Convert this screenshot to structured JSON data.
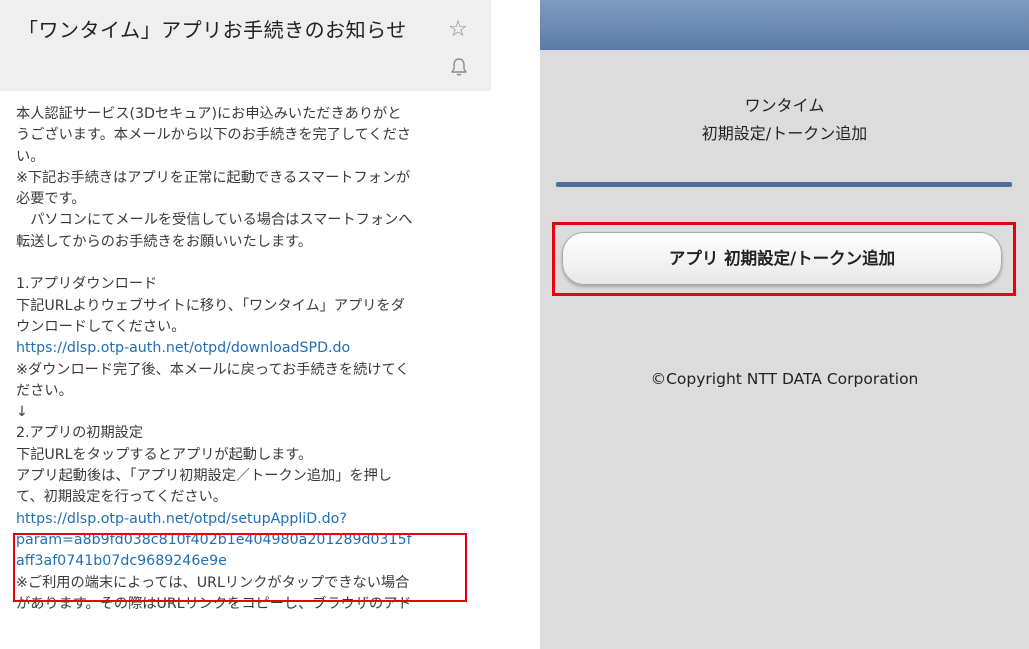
{
  "email": {
    "subject": "「ワンタイム」アプリお手続きのお知らせ",
    "icons": {
      "star": "star-icon",
      "bell": "bell-icon"
    },
    "body": {
      "intro": [
        "本人認証サービス(3Dセキュア)にお申込みいただきありがと",
        "うございます。本メールから以下のお手続きを完了してくださ",
        "い。",
        "※下記お手続きはアプリを正常に起動できるスマートフォンが",
        "必要です。",
        "　パソコンにてメールを受信している場合はスマートフォンへ",
        "転送してからのお手続きをお願いいたします。"
      ],
      "step1": {
        "heading": "1.アプリダウンロード",
        "text": [
          "下記URLよりウェブサイトに移り、「ワンタイム」アプリをダ",
          "ウンロードしてください。"
        ],
        "link": "https://dlsp.otp-auth.net/otpd/downloadSPD.do",
        "note": [
          "※ダウンロード完了後、本メールに戻ってお手続きを続けてく",
          "ださい。"
        ]
      },
      "arrow": "↓",
      "step2": {
        "heading": "2.アプリの初期設定",
        "text": [
          "下記URLをタップするとアプリが起動します。",
          "アプリ起動後は、「アプリ初期設定／トークン追加」を押し",
          "て、初期設定を行ってください。"
        ],
        "link_lines": [
          "https://dlsp.otp-auth.net/otpd/setupAppliD.do?",
          "param=a8b9fd038c810f402b1e404980a201289d0315f",
          "aff3af0741b07dc9689246e9e"
        ],
        "note": [
          "※ご利用の端末によっては、URLリンクがタップできない場合",
          "があります。その際はURLリンクをコピーし、ブラウザのアド"
        ]
      }
    }
  },
  "app": {
    "title_lines": [
      "ワンタイム",
      "初期設定/トークン追加"
    ],
    "button_label": "アプリ 初期設定/トークン追加",
    "copyright": "©Copyright NTT DATA Corporation"
  },
  "colors": {
    "link": "#1f6fb5",
    "highlight": "#e60012",
    "app_bar": "#6c88b3",
    "app_background": "#dcdcdc"
  }
}
